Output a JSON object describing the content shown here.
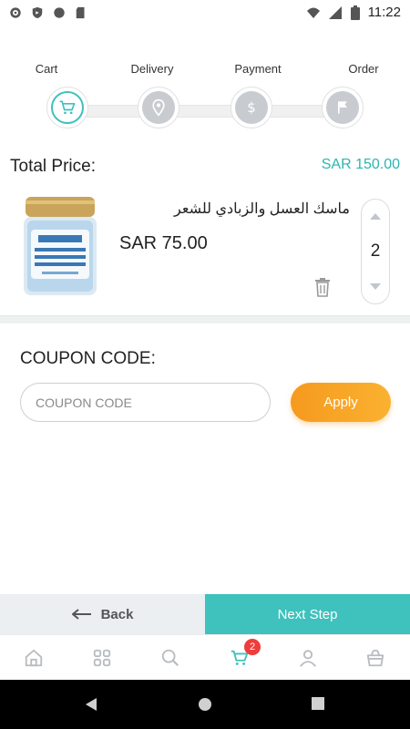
{
  "status_bar": {
    "time": "11:22"
  },
  "stepper": {
    "steps": [
      {
        "label": "Cart",
        "icon": "cart-icon",
        "active": true
      },
      {
        "label": "Delivery",
        "icon": "location-icon",
        "active": false
      },
      {
        "label": "Payment",
        "icon": "dollar-icon",
        "active": false
      },
      {
        "label": "Order",
        "icon": "flag-icon",
        "active": false
      }
    ]
  },
  "total": {
    "label": "Total Price:",
    "value": "SAR 150.00"
  },
  "cart_item": {
    "name": "ماسك العسل والزبادي للشعر",
    "price": "SAR 75.00",
    "quantity": "2"
  },
  "coupon": {
    "title": "COUPON CODE:",
    "placeholder": "COUPON CODE",
    "apply_label": "Apply"
  },
  "footer": {
    "back_label": "Back",
    "next_label": "Next Step"
  },
  "tabbar": {
    "items": [
      "home-icon",
      "grid-icon",
      "search-icon",
      "cart-icon",
      "user-icon",
      "basket-icon"
    ],
    "cart_badge": "2"
  },
  "colors": {
    "accent": "#3fc1bd",
    "price": "#2cb5b0",
    "apply": "#f7a328",
    "badge": "#f03c3c"
  }
}
